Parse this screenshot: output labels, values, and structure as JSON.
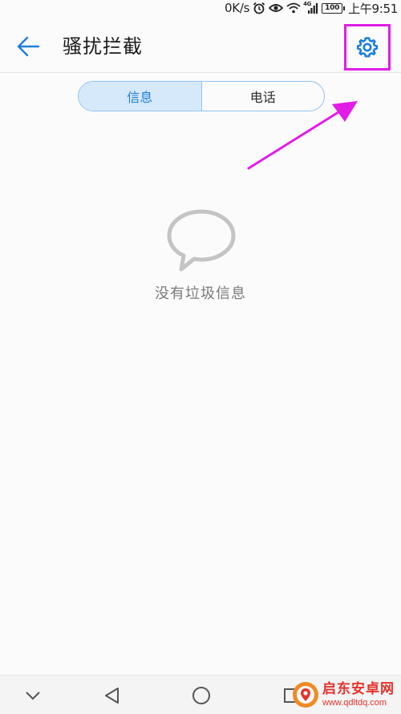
{
  "status_bar": {
    "speed": "0K/s",
    "signal": "4G",
    "battery": "100",
    "time": "上午9:51"
  },
  "header": {
    "title": "骚扰拦截"
  },
  "tabs": [
    {
      "label": "信息",
      "active": true
    },
    {
      "label": "电话",
      "active": false
    }
  ],
  "empty_state": {
    "message": "没有垃圾信息",
    "icon": "chat-bubble-icon"
  },
  "annotation": {
    "color": "#e11ce6"
  },
  "watermark": {
    "name": "启东安卓网",
    "url": "www.qdltdq.com"
  },
  "colors": {
    "accent": "#1d7fdc",
    "tab_active_bg": "#d6e9fb",
    "highlight": "#e11ce6"
  }
}
